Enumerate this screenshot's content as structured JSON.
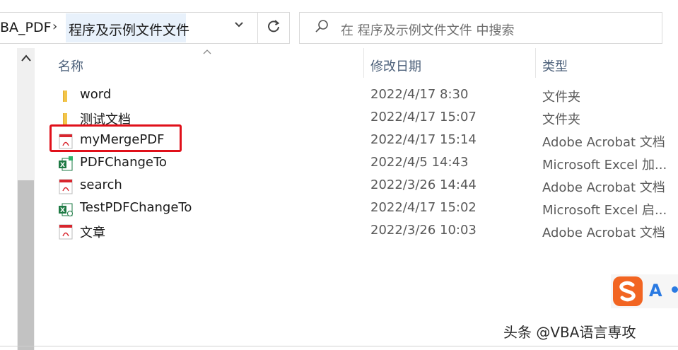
{
  "address_bar": {
    "parent_crumb": "BA_PDF",
    "separator": "›",
    "current_crumb": "程序及示例文件文件",
    "dropdown_icon": "chevron-down-icon",
    "refresh_icon": "refresh-icon"
  },
  "search": {
    "placeholder": "在 程序及示例文件文件 中搜索",
    "icon": "search-icon"
  },
  "columns": {
    "name": "名称",
    "modified": "修改日期",
    "type": "类型"
  },
  "files": [
    {
      "icon": "folder-icon",
      "name": "word",
      "modified": "2022/4/17 8:30",
      "type": "文件夹"
    },
    {
      "icon": "folder-icon",
      "name": "测试文档",
      "modified": "2022/4/17 15:07",
      "type": "文件夹"
    },
    {
      "icon": "pdf-icon",
      "name": "myMergePDF",
      "modified": "2022/4/17 15:14",
      "type": "Adobe Acrobat 文档",
      "highlighted": true
    },
    {
      "icon": "excel-addin-icon",
      "name": "PDFChangeTo",
      "modified": "2022/4/5 14:43",
      "type": "Microsoft Excel 加..."
    },
    {
      "icon": "pdf-icon",
      "name": "search",
      "modified": "2022/3/26 14:44",
      "type": "Adobe Acrobat 文档"
    },
    {
      "icon": "excel-macro-icon",
      "name": "TestPDFChangeTo",
      "modified": "2022/4/17 15:02",
      "type": "Microsoft Excel 启..."
    },
    {
      "icon": "pdf-icon",
      "name": "文章",
      "modified": "2022/3/26 10:03",
      "type": "Adobe Acrobat 文档"
    }
  ],
  "ime": {
    "letter": "A"
  },
  "watermark": "头条 @VBA语言専攻",
  "colors": {
    "highlight": "#e0101a",
    "folder": "#f2c54a",
    "pdf": "#d8262e",
    "excel": "#1e7a44"
  }
}
